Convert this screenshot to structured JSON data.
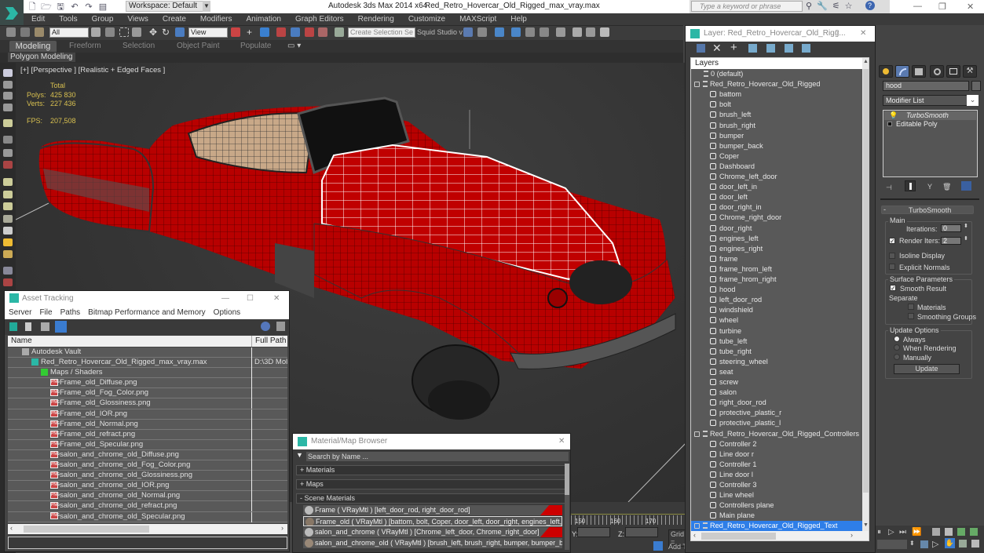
{
  "titlebar": {
    "workspace": "Workspace: Default",
    "app_title": "Autodesk 3ds Max  2014 x64",
    "file_title": "Red_Retro_Hovercar_Old_Rigged_max_vray.max",
    "search_placeholder": "Type a keyword or phrase",
    "minimize": "—",
    "restore": "❐",
    "close": "✕"
  },
  "menu": [
    "Edit",
    "Tools",
    "Group",
    "Views",
    "Create",
    "Modifiers",
    "Animation",
    "Graph Editors",
    "Rendering",
    "Customize",
    "MAXScript",
    "Help"
  ],
  "toolbar": {
    "selection_filter": "All",
    "reference_coord": "View",
    "named_selection_placeholder": "Create Selection Se",
    "squid_studio": "Squid Studio v"
  },
  "ribbon": {
    "tabs": [
      "Modeling",
      "Freeform",
      "Selection",
      "Object Paint",
      "Populate"
    ],
    "active_tab": "Modeling",
    "panel": "Polygon Modeling"
  },
  "viewport": {
    "label": "[+] [Perspective ] [Realistic + Edged Faces ]",
    "stats": {
      "total_label": "Total",
      "polys_label": "Polys:",
      "polys": "425 830",
      "verts_label": "Verts:",
      "verts": "227 436",
      "fps_label": "FPS:",
      "fps": "207,508"
    }
  },
  "asset_tracking": {
    "title": "Asset Tracking",
    "menu": [
      "Server",
      "File",
      "Paths",
      "Bitmap Performance and Memory",
      "Options"
    ],
    "columns": [
      "Name",
      "Full Path"
    ],
    "rows": [
      {
        "name": "Autodesk Vault",
        "path": "",
        "level": 0,
        "icon": "vault-icon"
      },
      {
        "name": "Red_Retro_Hovercar_Old_Rigged_max_vray.max",
        "path": "D:\\3D Mol",
        "level": 1,
        "icon": "max-file-icon"
      },
      {
        "name": "Maps / Shaders",
        "path": "",
        "level": 2,
        "icon": "maps-icon"
      },
      {
        "name": "Frame_old_Diffuse.png",
        "path": "",
        "level": 3,
        "icon": "png-icon"
      },
      {
        "name": "Frame_old_Fog_Color.png",
        "path": "",
        "level": 3,
        "icon": "png-icon"
      },
      {
        "name": "Frame_old_Glossiness.png",
        "path": "",
        "level": 3,
        "icon": "png-icon"
      },
      {
        "name": "Frame_old_IOR.png",
        "path": "",
        "level": 3,
        "icon": "png-icon"
      },
      {
        "name": "Frame_old_Normal.png",
        "path": "",
        "level": 3,
        "icon": "png-icon"
      },
      {
        "name": "Frame_old_refract.png",
        "path": "",
        "level": 3,
        "icon": "png-icon"
      },
      {
        "name": "Frame_old_Specular.png",
        "path": "",
        "level": 3,
        "icon": "png-icon"
      },
      {
        "name": "salon_and_chrome_old_Diffuse.png",
        "path": "",
        "level": 3,
        "icon": "png-icon"
      },
      {
        "name": "salon_and_chrome_old_Fog_Color.png",
        "path": "",
        "level": 3,
        "icon": "png-icon"
      },
      {
        "name": "salon_and_chrome_old_Glossiness.png",
        "path": "",
        "level": 3,
        "icon": "png-icon"
      },
      {
        "name": "salon_and_chrome_old_IOR.png",
        "path": "",
        "level": 3,
        "icon": "png-icon"
      },
      {
        "name": "salon_and_chrome_old_Normal.png",
        "path": "",
        "level": 3,
        "icon": "png-icon"
      },
      {
        "name": "salon_and_chrome_old_refract.png",
        "path": "",
        "level": 3,
        "icon": "png-icon"
      },
      {
        "name": "salon_and_chrome_old_Specular.png",
        "path": "",
        "level": 3,
        "icon": "png-icon"
      }
    ]
  },
  "material_browser": {
    "title": "Material/Map Browser",
    "search_placeholder": "Search by Name ...",
    "sections": [
      "+ Materials",
      "+ Maps",
      "- Scene Materials"
    ],
    "items": [
      "Frame  ( VRayMtl ) [left_door_rod, right_door_rod]",
      "Frame_old  ( VRayMtl ) [battom, bolt, Coper, door_left, door_right, engines_left,...",
      "salon_and_chrome  ( VRayMtl ) [Chrome_left_door, Chrome_right_door]",
      "salon_and_chrome_old  ( VRayMtl ) [brush_left, brush_right, bumper, bumper_b..."
    ]
  },
  "timeline": {
    "ticks": [
      "150",
      "160",
      "170"
    ],
    "y_label": "Y:",
    "z_label": "Z:",
    "grid_label": "Grid =",
    "add_time_tag": "Add T"
  },
  "layer_window": {
    "title": "Layer: Red_Retro_Hovercar_Old_Rigg...",
    "help": "?",
    "close": "✕",
    "header": "Layers",
    "layers": [
      {
        "name": "0 (default)",
        "type": "layer",
        "indent": 0
      },
      {
        "name": "Red_Retro_Hovercar_Old_Rigged",
        "type": "layer",
        "indent": 0
      },
      {
        "name": "battom",
        "type": "object",
        "indent": 1
      },
      {
        "name": "bolt",
        "type": "object",
        "indent": 1
      },
      {
        "name": "brush_left",
        "type": "object",
        "indent": 1
      },
      {
        "name": "brush_right",
        "type": "object",
        "indent": 1
      },
      {
        "name": "bumper",
        "type": "object",
        "indent": 1
      },
      {
        "name": "bumper_back",
        "type": "object",
        "indent": 1
      },
      {
        "name": "Coper",
        "type": "object",
        "indent": 1
      },
      {
        "name": "Dashboard",
        "type": "object",
        "indent": 1
      },
      {
        "name": "Chrome_left_door",
        "type": "object",
        "indent": 1
      },
      {
        "name": "door_left_in",
        "type": "object",
        "indent": 1
      },
      {
        "name": "door_left",
        "type": "object",
        "indent": 1
      },
      {
        "name": "door_right_in",
        "type": "object",
        "indent": 1
      },
      {
        "name": "Chrome_right_door",
        "type": "object",
        "indent": 1
      },
      {
        "name": "door_right",
        "type": "object",
        "indent": 1
      },
      {
        "name": "engines_left",
        "type": "object",
        "indent": 1
      },
      {
        "name": "engines_right",
        "type": "object",
        "indent": 1
      },
      {
        "name": "frame",
        "type": "object",
        "indent": 1
      },
      {
        "name": "frame_hrom_left",
        "type": "object",
        "indent": 1
      },
      {
        "name": "frame_hrom_right",
        "type": "object",
        "indent": 1
      },
      {
        "name": "hood",
        "type": "object",
        "indent": 1
      },
      {
        "name": "left_door_rod",
        "type": "object",
        "indent": 1
      },
      {
        "name": "windshield",
        "type": "object",
        "indent": 1
      },
      {
        "name": "wheel",
        "type": "object",
        "indent": 1
      },
      {
        "name": "turbine",
        "type": "object",
        "indent": 1
      },
      {
        "name": "tube_left",
        "type": "object",
        "indent": 1
      },
      {
        "name": "tube_right",
        "type": "object",
        "indent": 1
      },
      {
        "name": "steering_wheel",
        "type": "object",
        "indent": 1
      },
      {
        "name": "seat",
        "type": "object",
        "indent": 1
      },
      {
        "name": "screw",
        "type": "object",
        "indent": 1
      },
      {
        "name": "salon",
        "type": "object",
        "indent": 1
      },
      {
        "name": "right_door_rod",
        "type": "object",
        "indent": 1
      },
      {
        "name": "protective_plastic_r",
        "type": "object",
        "indent": 1
      },
      {
        "name": "protective_plastic_l",
        "type": "object",
        "indent": 1
      },
      {
        "name": "Red_Retro_Hovercar_Old_Rigged_Controllers",
        "type": "layer",
        "indent": 0
      },
      {
        "name": "Controller 2",
        "type": "object",
        "indent": 1
      },
      {
        "name": "Line door r",
        "type": "object",
        "indent": 1
      },
      {
        "name": "Controller 1",
        "type": "object",
        "indent": 1
      },
      {
        "name": "Line door l",
        "type": "object",
        "indent": 1
      },
      {
        "name": "Controller 3",
        "type": "object",
        "indent": 1
      },
      {
        "name": "Line wheel",
        "type": "object",
        "indent": 1
      },
      {
        "name": "Controllers plane",
        "type": "object",
        "indent": 1
      },
      {
        "name": "Main plane",
        "type": "object",
        "indent": 1
      },
      {
        "name": "Red_Retro_Hovercar_Old_Rigged_Text",
        "type": "layer",
        "indent": 0,
        "selected": true
      }
    ]
  },
  "command_panel": {
    "object_name": "hood",
    "modifier_list": "Modifier List",
    "stack": [
      "TurboSmooth",
      "Editable Poly"
    ],
    "turbosmooth": {
      "title": "TurboSmooth",
      "main_group": "Main",
      "iterations_label": "Iterations:",
      "iterations": "0",
      "render_iters_label": "Render Iters:",
      "render_iters": "2",
      "render_iters_checked": true,
      "isoline_label": "Isoline Display",
      "isoline_checked": false,
      "explicit_normals_label": "Explicit Normals",
      "explicit_normals_checked": false,
      "surface_group": "Surface Parameters",
      "smooth_result_label": "Smooth Result",
      "smooth_result_checked": true,
      "separate_label": "Separate",
      "materials_label": "Materials",
      "materials_checked": false,
      "smoothing_groups_label": "Smoothing Groups",
      "smoothing_groups_checked": false,
      "update_group": "Update Options",
      "update_options": [
        "Always",
        "When Rendering",
        "Manually"
      ],
      "update_selected": "Always",
      "update_button": "Update"
    }
  },
  "colors": {
    "accent": "#3399ff",
    "selection": "#2e7ee8",
    "car_red": "#c40000",
    "stats_yellow": "#d8c050"
  }
}
